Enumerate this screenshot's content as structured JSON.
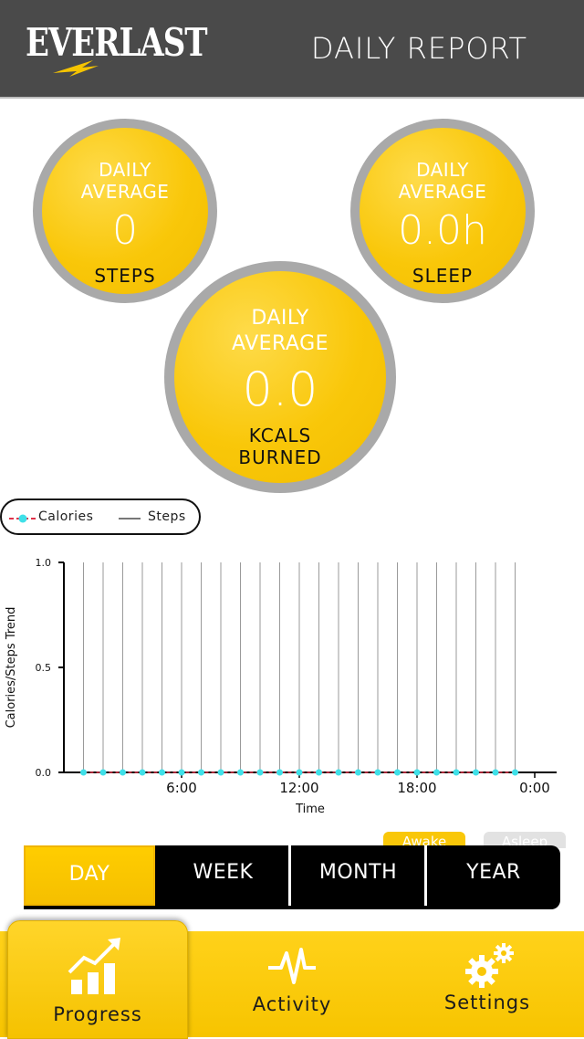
{
  "header": {
    "brand": "EVERLAST",
    "title": "DAILY REPORT"
  },
  "stats": {
    "steps": {
      "line1": "DAILY",
      "line2": "AVERAGE",
      "value": "0",
      "unit": "STEPS"
    },
    "sleep": {
      "line1": "DAILY",
      "line2": "AVERAGE",
      "value": "0.0h",
      "unit": "SLEEP"
    },
    "kcals": {
      "line1": "DAILY",
      "line2": "AVERAGE",
      "value": "0.0",
      "unit1": "KCALS",
      "unit2": "BURNED"
    }
  },
  "legend": {
    "calories": "Calories",
    "steps": "Steps"
  },
  "chart_data": {
    "type": "line",
    "xlabel": "Time",
    "ylabel": "Calories/Steps Trend",
    "ylim": [
      0,
      1
    ],
    "yticks": [
      "0.0",
      "0.5",
      "1.0"
    ],
    "xticks": [
      "6:00",
      "12:00",
      "18:00",
      "0:00"
    ],
    "x": [
      "1:00",
      "2:00",
      "3:00",
      "4:00",
      "5:00",
      "6:00",
      "7:00",
      "8:00",
      "9:00",
      "10:00",
      "11:00",
      "12:00",
      "13:00",
      "14:00",
      "15:00",
      "16:00",
      "17:00",
      "18:00",
      "19:00",
      "20:00",
      "21:00",
      "22:00",
      "23:00"
    ],
    "series": [
      {
        "name": "Calories",
        "values": [
          0,
          0,
          0,
          0,
          0,
          0,
          0,
          0,
          0,
          0,
          0,
          0,
          0,
          0,
          0,
          0,
          0,
          0,
          0,
          0,
          0,
          0,
          0
        ],
        "color": "#3fe0e8"
      },
      {
        "name": "Steps",
        "values": [
          0,
          0,
          0,
          0,
          0,
          0,
          0,
          0,
          0,
          0,
          0,
          0,
          0,
          0,
          0,
          0,
          0,
          0,
          0,
          0,
          0,
          0,
          0
        ],
        "color": "#9a9a9a"
      }
    ]
  },
  "sleep_toggle": {
    "awake": "Awake",
    "asleep": "Asleep"
  },
  "periods": [
    "DAY",
    "WEEK",
    "MONTH",
    "YEAR"
  ],
  "tabs": {
    "progress": "Progress",
    "activity": "Activity",
    "settings": "Settings"
  },
  "colors": {
    "accent": "#f9c709",
    "header": "#4a4a4a",
    "ring": "#a9a9a9"
  }
}
